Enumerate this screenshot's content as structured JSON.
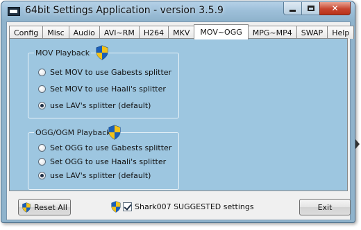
{
  "window": {
    "title": "64bit Settings Application - version 3.5.9"
  },
  "tabs": [
    {
      "label": "Config",
      "active": false
    },
    {
      "label": "Misc",
      "active": false
    },
    {
      "label": "Audio",
      "active": false
    },
    {
      "label": "AVI~RM",
      "active": false
    },
    {
      "label": "H264",
      "active": false
    },
    {
      "label": "MKV",
      "active": false
    },
    {
      "label": "MOV~OGG",
      "active": true
    },
    {
      "label": "MPG~MP4",
      "active": false
    },
    {
      "label": "SWAP",
      "active": false
    },
    {
      "label": "Help",
      "active": false
    }
  ],
  "mov_group": {
    "title": "MOV Playback",
    "icon": "uac-shield-icon",
    "options": [
      {
        "label": "Set MOV to use Gabests splitter",
        "selected": false
      },
      {
        "label": "Set MOV to use Haali's splitter",
        "selected": false
      },
      {
        "label": "use LAV's splitter (default)",
        "selected": true
      }
    ]
  },
  "ogg_group": {
    "title": "OGG/OGM Playback",
    "icon": "uac-shield-icon",
    "options": [
      {
        "label": "Set OGG to use Gabests splitter",
        "selected": false
      },
      {
        "label": "Set OGG to use Haali's splitter",
        "selected": false
      },
      {
        "label": "use LAV's splitter (default)",
        "selected": true
      }
    ]
  },
  "footer": {
    "reset_label": "Reset All",
    "suggested_label": "Shark007 SUGGESTED settings",
    "suggested_checked": true,
    "exit_label": "Exit"
  },
  "colors": {
    "panel_background": "#9dc6e0",
    "title_bar": "#9ec0da",
    "close_button": "#c7452f"
  }
}
